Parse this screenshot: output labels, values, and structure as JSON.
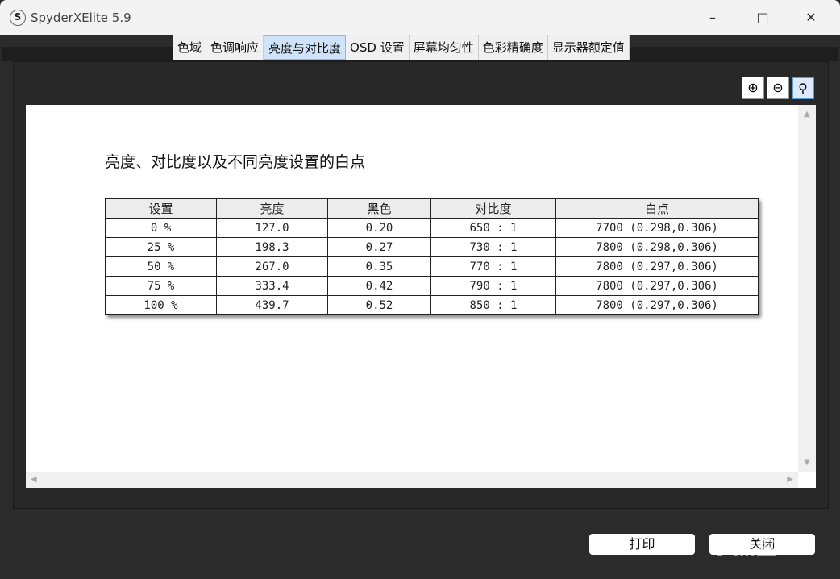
{
  "window": {
    "title": "SpyderXElite 5.9",
    "logo_letter": "S"
  },
  "tabs": [
    {
      "label": "色域"
    },
    {
      "label": "色调响应"
    },
    {
      "label": "亮度与对比度",
      "active": true
    },
    {
      "label": "OSD 设置"
    },
    {
      "label": "屏幕均匀性"
    },
    {
      "label": "色彩精确度"
    },
    {
      "label": "显示器额定值"
    }
  ],
  "zoom_tools": {
    "zoom_in": "zoom-in-icon",
    "zoom_out": "zoom-out-icon",
    "fit": "zoom-fit-icon"
  },
  "report": {
    "heading": "亮度、对比度以及不同亮度设置的白点",
    "columns": [
      "设置",
      "亮度",
      "黑色",
      "对比度",
      "白点"
    ],
    "rows": [
      [
        "0 %",
        "127.0",
        "0.20",
        "650 : 1",
        "7700 (0.298,0.306)"
      ],
      [
        "25 %",
        "198.3",
        "0.27",
        "730 : 1",
        "7800 (0.298,0.306)"
      ],
      [
        "50 %",
        "267.0",
        "0.35",
        "770 : 1",
        "7800 (0.297,0.306)"
      ],
      [
        "75 %",
        "333.4",
        "0.42",
        "790 : 1",
        "7800 (0.297,0.306)"
      ],
      [
        "100 %",
        "439.7",
        "0.52",
        "850 : 1",
        "7800 (0.297,0.306)"
      ]
    ]
  },
  "buttons": {
    "print": "打印",
    "close": "关闭"
  },
  "watermark": "小黑盒"
}
